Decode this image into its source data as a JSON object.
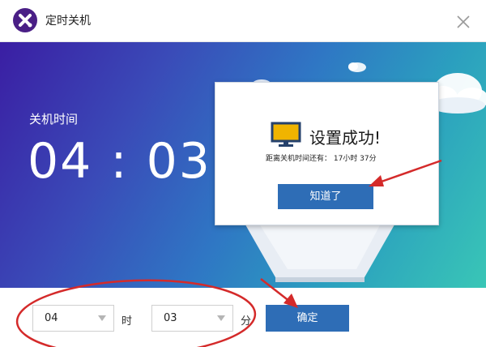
{
  "window": {
    "title": "定时关机"
  },
  "hero": {
    "label": "关机时间",
    "hours": "04",
    "separator": ":",
    "minutes": "03"
  },
  "dialog": {
    "title": "设置成功!",
    "subtitle": "距离关机时间还有： 17小时 37分",
    "button_label": "知道了"
  },
  "controls": {
    "hour_value": "04",
    "hour_unit": "时",
    "minute_value": "03",
    "minute_unit": "分",
    "confirm_label": "确定"
  },
  "colors": {
    "accent": "#2e6db6",
    "logo": "#4a1f86",
    "annotation": "#d42a2a"
  },
  "icons": [
    "app-logo-icon",
    "close-icon",
    "monitor-icon",
    "chevron-down-icon"
  ]
}
